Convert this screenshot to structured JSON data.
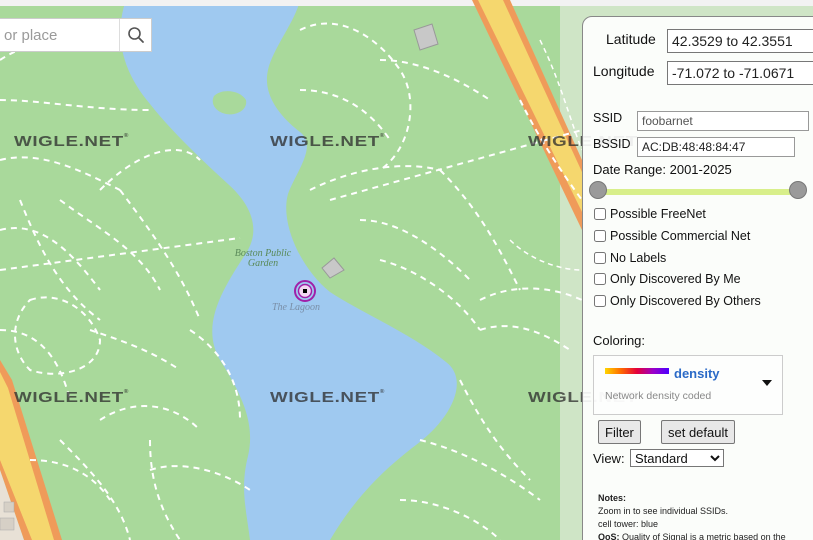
{
  "search": {
    "placeholder": "or place"
  },
  "icons": {
    "search": "search-icon",
    "marker": "location-marker-icon",
    "dropdown": "caret-down-icon"
  },
  "map": {
    "labels": {
      "garden": "Boston Public Garden",
      "lagoon": "The Lagoon"
    },
    "watermark": "WIGLE.NET",
    "colors": {
      "grass": "#a9d99b",
      "water": "#9fc9f0",
      "road": "#f5d76e",
      "road_edge": "#ef9b5a",
      "paths": "#ffffff",
      "marker": "#a020a8"
    }
  },
  "panel": {
    "latitude_label": "Latitude",
    "latitude_value": "42.3529 to 42.3551",
    "longitude_label": "Longitude",
    "longitude_value": "-71.072 to -71.0671",
    "ssid_label": "SSID",
    "ssid_value": "foobarnet",
    "bssid_label": "BSSID",
    "bssid_value": "AC:DB:48:48:84:47",
    "date_range_label": "Date Range: 2001-2025",
    "checkboxes": [
      {
        "label": "Possible FreeNet",
        "checked": false
      },
      {
        "label": "Possible Commercial Net",
        "checked": false
      },
      {
        "label": "No Labels",
        "checked": false
      },
      {
        "label": "Only Discovered By Me",
        "checked": false
      },
      {
        "label": "Only Discovered By Others",
        "checked": false
      }
    ],
    "coloring_label": "Coloring:",
    "coloring_value": "density",
    "coloring_note": "Network density coded",
    "filter_button": "Filter",
    "default_button": "set default",
    "view_label": "View:",
    "view_value": "Standard",
    "notes_title": "Notes:",
    "notes_lines": [
      "Zoom in to see individual SSIDs.",
      "cell tower: blue"
    ],
    "notes_qos_label": "QoS:",
    "notes_qos_text": "Quality of Signal is a metric based on the"
  }
}
